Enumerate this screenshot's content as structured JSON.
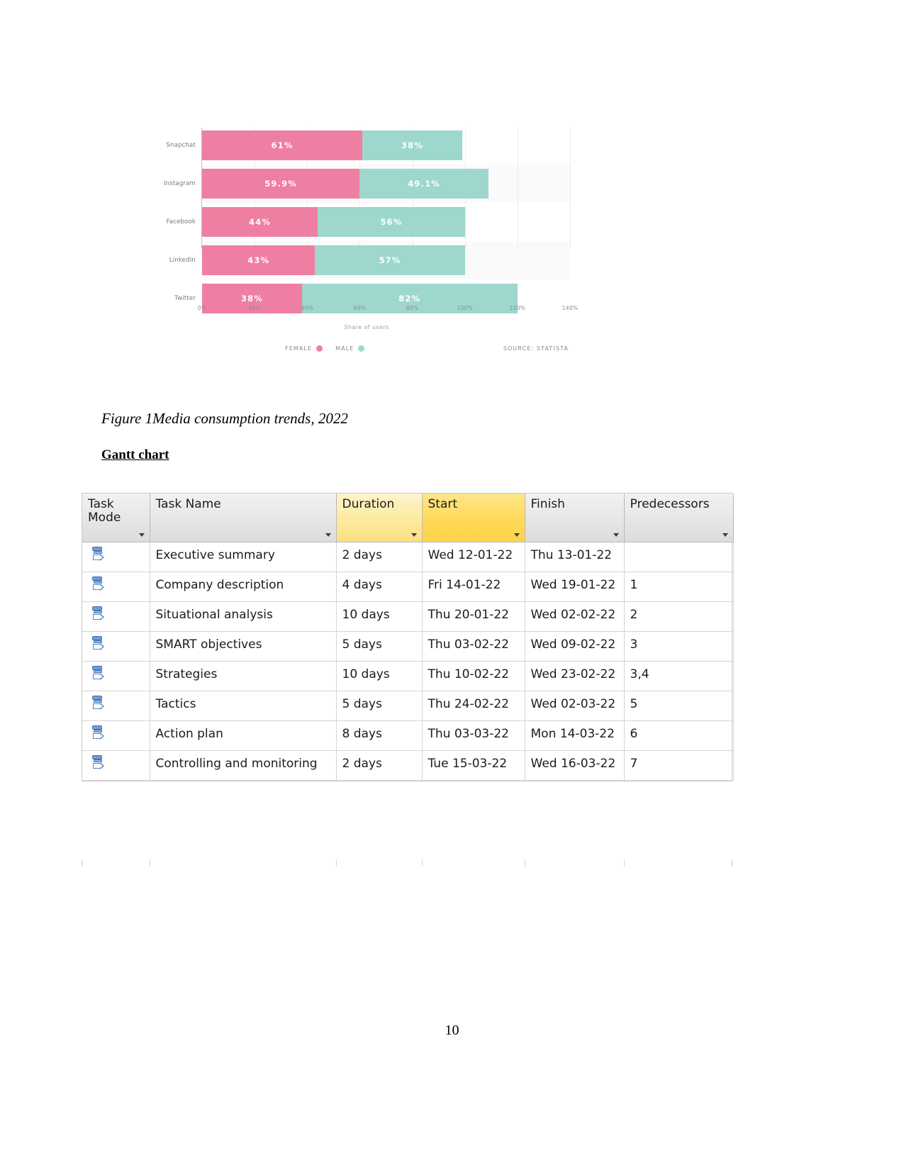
{
  "document": {
    "page_number": "10",
    "figure_caption": "Figure 1Media consumption trends, 2022",
    "section_heading": "Gantt chart"
  },
  "chart_data": {
    "type": "bar",
    "orientation": "horizontal",
    "stacked": true,
    "title": "",
    "xlabel": "Share of users",
    "ylabel": "",
    "xlim": [
      0,
      140
    ],
    "grid": true,
    "legend_position": "bottom-left",
    "source": "SOURCE: STATISTA",
    "categories": [
      "Snapchat",
      "Instagram",
      "Facebook",
      "LinkedIn",
      "Twitter"
    ],
    "x_ticks": [
      "0%",
      "20%",
      "40%",
      "60%",
      "80%",
      "100%",
      "120%",
      "140%"
    ],
    "x_tick_values": [
      0,
      20,
      40,
      60,
      80,
      100,
      120,
      140
    ],
    "series": [
      {
        "name": "FEMALE",
        "color": "#ef7fa2",
        "values": [
          61,
          59.9,
          44,
          43,
          38
        ],
        "labels": [
          "61%",
          "59.9%",
          "44%",
          "43%",
          "38%"
        ]
      },
      {
        "name": "MALE",
        "color": "#9ed7cd",
        "values": [
          38,
          49.1,
          56,
          57,
          82
        ],
        "labels": [
          "38%",
          "49.1%",
          "56%",
          "57%",
          "82%"
        ]
      }
    ]
  },
  "gantt": {
    "columns": [
      {
        "label": "Task Mode",
        "highlight": "none"
      },
      {
        "label": "Task Name",
        "highlight": "none"
      },
      {
        "label": "Duration",
        "highlight": "light"
      },
      {
        "label": "Start",
        "highlight": "strong"
      },
      {
        "label": "Finish",
        "highlight": "none"
      },
      {
        "label": "Predecessors",
        "highlight": "none"
      }
    ],
    "rows": [
      {
        "mode": "auto-scheduled",
        "name": "Executive summary",
        "duration": "2 days",
        "start": "Wed 12-01-22",
        "finish": "Thu 13-01-22",
        "predecessors": ""
      },
      {
        "mode": "auto-scheduled",
        "name": "Company description",
        "duration": "4 days",
        "start": "Fri 14-01-22",
        "finish": "Wed 19-01-22",
        "predecessors": "1"
      },
      {
        "mode": "auto-scheduled",
        "name": "Situational analysis",
        "duration": "10 days",
        "start": "Thu 20-01-22",
        "finish": "Wed 02-02-22",
        "predecessors": "2"
      },
      {
        "mode": "auto-scheduled",
        "name": "SMART objectives",
        "duration": "5 days",
        "start": "Thu 03-02-22",
        "finish": "Wed 09-02-22",
        "predecessors": "3"
      },
      {
        "mode": "auto-scheduled",
        "name": "Strategies",
        "duration": "10 days",
        "start": "Thu 10-02-22",
        "finish": "Wed 23-02-22",
        "predecessors": "3,4"
      },
      {
        "mode": "auto-scheduled",
        "name": "Tactics",
        "duration": "5 days",
        "start": "Thu 24-02-22",
        "finish": "Wed 02-03-22",
        "predecessors": "5"
      },
      {
        "mode": "auto-scheduled",
        "name": "Action plan",
        "duration": "8 days",
        "start": "Thu 03-03-22",
        "finish": "Mon 14-03-22",
        "predecessors": "6"
      },
      {
        "mode": "auto-scheduled",
        "name": "Controlling and monitoring",
        "duration": "2 days",
        "start": "Tue 15-03-22",
        "finish": "Wed 16-03-22",
        "predecessors": "7"
      }
    ]
  }
}
